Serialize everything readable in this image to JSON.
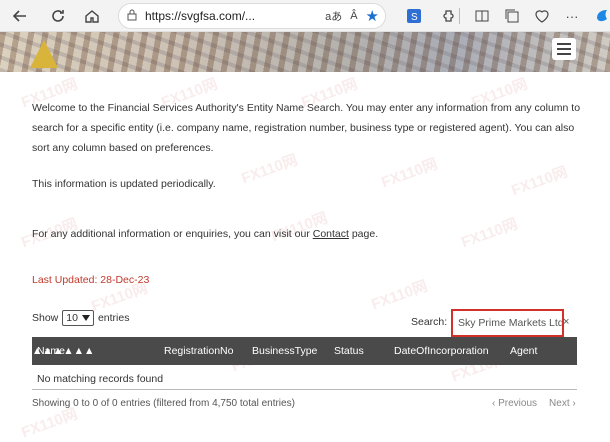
{
  "browser": {
    "url": "https://svgfsa.com/...",
    "reader_label": "aあ",
    "read_aloud_label": "Â",
    "more_label": "···"
  },
  "intro": "Welcome to the Financial Services Authority's Entity Name Search. You may enter any information from any column to search for a specific entity (i.e. company name, registration number, business type or registered agent). You can also sort any column based on preferences.",
  "updated_note": "This information is updated periodically.",
  "contact": {
    "before": "For any additional information or enquiries, you can visit our ",
    "link": "Contact",
    "after": " page."
  },
  "last_updated": "Last Updated:  28-Dec-23",
  "entries": {
    "show_label": "Show",
    "page_size": "10",
    "entries_label": "entries"
  },
  "search": {
    "label": "Search:",
    "value": "Sky Prime Markets Ltd",
    "clear": "×"
  },
  "table": {
    "columns": [
      "Name",
      "RegistrationNo",
      "BusinessType",
      "Status",
      "DateOfIncorporation",
      "Agent"
    ],
    "empty": "No matching records found"
  },
  "footer": {
    "info": "Showing 0 to 0 of 0 entries (filtered from 4,750 total entries)",
    "previous": "Previous",
    "next": "Next"
  },
  "watermark": "FX110网"
}
